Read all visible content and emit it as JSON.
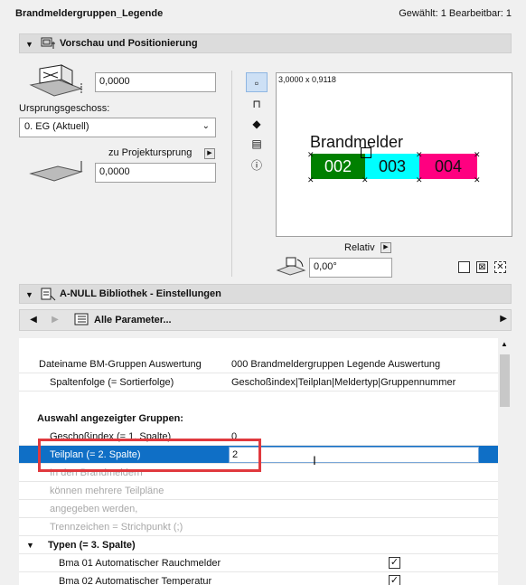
{
  "header": {
    "title": "Brandmeldergruppen_Legende",
    "selection_info": "Gewählt: 1 Bearbeitbar: 1"
  },
  "section_preview": {
    "label": "Vorschau und Positionierung",
    "height_value": "0,0000",
    "home_story_label": "Ursprungsgeschoss:",
    "home_story_value": "0. EG (Aktuell)",
    "to_project_zero_label": "zu Projektursprung",
    "project_zero_value": "0,0000",
    "preview_size": "3,0000 x 0,9118",
    "preview_title": "Brandmelder",
    "preview_cells": [
      {
        "text": "002",
        "color": "#008000",
        "text_color": "#ffffff"
      },
      {
        "text": "003",
        "color": "#00ffff",
        "text_color": "#111111"
      },
      {
        "text": "004",
        "color": "#ff0080",
        "text_color": "#111111"
      }
    ],
    "relativ_label": "Relativ",
    "angle_value": "0,00°"
  },
  "section_library": {
    "label": "A-NULL Bibliothek - Einstellungen",
    "param_selector": "Alle Parameter..."
  },
  "params": [
    {
      "label": "Dateiname BM-Gruppen Auswertung",
      "value": "000 Brandmeldergruppen Legende Auswertung",
      "indent": 22
    },
    {
      "label": "Spaltenfolge (= Sortierfolge)",
      "value": "Geschoßindex|Teilplan|Meldertyp|Gruppennummer",
      "indent": 34
    },
    {
      "label": "Auswahl angezeigter Gruppen:",
      "value": "",
      "indent": 20
    },
    {
      "label": "Geschoßindex (= 1. Spalte)",
      "value": "0",
      "indent": 34
    },
    {
      "label": "Teilplan (= 2. Spalte)",
      "value": "2",
      "indent": 34
    },
    {
      "label": "In den Brandmeldern",
      "value": "",
      "indent": 34
    },
    {
      "label": "können mehrere Teilpläne",
      "value": "",
      "indent": 34
    },
    {
      "label": "angegeben werden,",
      "value": "",
      "indent": 34
    },
    {
      "label": "Trennzeichen = Strichpunkt (;)",
      "value": "",
      "indent": 34
    },
    {
      "label": "Typen (= 3. Spalte)",
      "value": "",
      "indent": 32
    },
    {
      "label": "Bma 01 Automatischer Rauchmelder",
      "value": "",
      "indent": 44
    },
    {
      "label": "Bma 02 Automatischer Temperatur",
      "value": "",
      "indent": 44
    }
  ],
  "colors": {
    "selection": "#0f6fc6",
    "highlight_box": "#e0393e"
  }
}
